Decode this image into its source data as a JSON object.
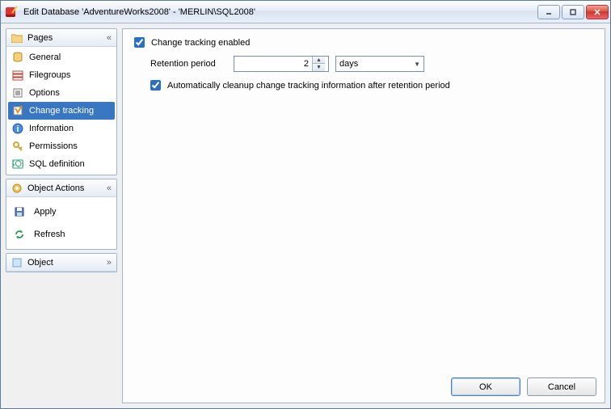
{
  "window": {
    "title": "Edit Database 'AdventureWorks2008' - 'MERLIN\\SQL2008'"
  },
  "sidebar": {
    "pages": {
      "header": "Pages",
      "items": [
        {
          "label": "General"
        },
        {
          "label": "Filegroups"
        },
        {
          "label": "Options"
        },
        {
          "label": "Change tracking"
        },
        {
          "label": "Information"
        },
        {
          "label": "Permissions"
        },
        {
          "label": "SQL definition"
        }
      ]
    },
    "actions": {
      "header": "Object Actions",
      "items": [
        {
          "label": "Apply"
        },
        {
          "label": "Refresh"
        }
      ]
    },
    "object": {
      "header": "Object"
    }
  },
  "main": {
    "enable_label": "Change tracking enabled",
    "enable_checked": true,
    "retention_label": "Retention period",
    "retention_value": "2",
    "retention_unit": "days",
    "auto_cleanup_label": "Automatically cleanup change tracking information after retention period",
    "auto_cleanup_checked": true
  },
  "buttons": {
    "ok": "OK",
    "cancel": "Cancel"
  }
}
